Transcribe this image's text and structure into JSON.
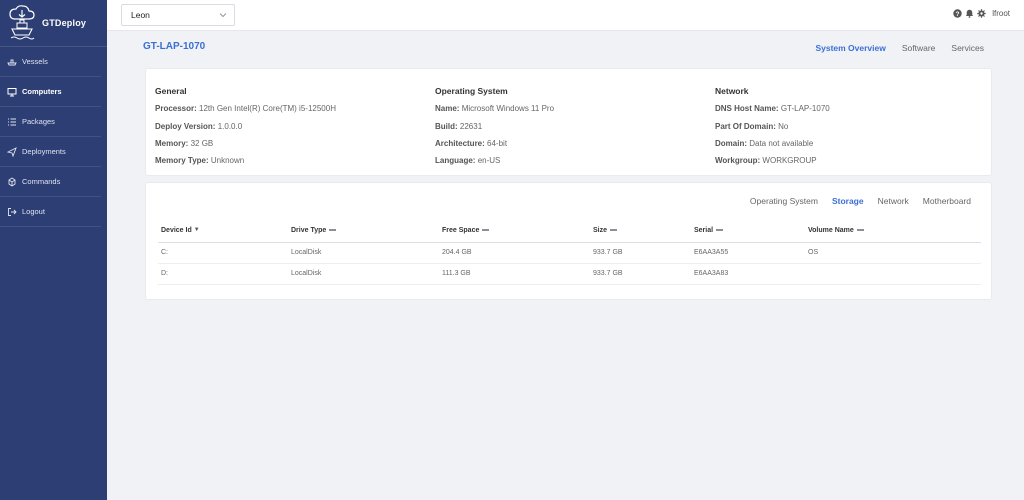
{
  "app": {
    "name": "GTDeploy"
  },
  "sidebar": {
    "items": [
      {
        "label": "Vessels",
        "icon": "ship-icon",
        "active": false
      },
      {
        "label": "Computers",
        "icon": "computer-icon",
        "active": true
      },
      {
        "label": "Packages",
        "icon": "list-icon",
        "active": false
      },
      {
        "label": "Deployments",
        "icon": "send-icon",
        "active": false
      },
      {
        "label": "Commands",
        "icon": "commands-icon",
        "active": false
      },
      {
        "label": "Logout",
        "icon": "logout-icon",
        "active": false
      }
    ]
  },
  "topbar": {
    "selected_site": "Leon",
    "user": "lfroot",
    "icons": [
      "help-icon",
      "bell-icon",
      "gear-icon"
    ]
  },
  "page": {
    "title": "GT-LAP-1070",
    "tabs": [
      {
        "label": "System Overview",
        "active": true
      },
      {
        "label": "Software",
        "active": false
      },
      {
        "label": "Services",
        "active": false
      }
    ]
  },
  "overview": {
    "general": {
      "heading": "General",
      "rows": [
        {
          "key": "Processor:",
          "value": "12th Gen Intel(R) Core(TM) i5-12500H"
        },
        {
          "key": "Deploy Version:",
          "value": "1.0.0.0"
        },
        {
          "key": "Memory:",
          "value": "32 GB"
        },
        {
          "key": "Memory Type:",
          "value": "Unknown"
        }
      ]
    },
    "os": {
      "heading": "Operating System",
      "rows": [
        {
          "key": "Name:",
          "value": "Microsoft Windows 11 Pro"
        },
        {
          "key": "Build:",
          "value": "22631"
        },
        {
          "key": "Architecture:",
          "value": "64-bit"
        },
        {
          "key": "Language:",
          "value": "en-US"
        }
      ]
    },
    "network": {
      "heading": "Network",
      "rows": [
        {
          "key": "DNS Host Name:",
          "value": "GT-LAP-1070"
        },
        {
          "key": "Part Of Domain:",
          "value": "No"
        },
        {
          "key": "Domain:",
          "value": "Data not available"
        },
        {
          "key": "Workgroup:",
          "value": "WORKGROUP"
        }
      ]
    }
  },
  "detail_tabs": [
    {
      "label": "Operating System",
      "active": false
    },
    {
      "label": "Storage",
      "active": true
    },
    {
      "label": "Network",
      "active": false
    },
    {
      "label": "Motherboard",
      "active": false
    }
  ],
  "storage_table": {
    "columns": [
      "Device Id",
      "Drive Type",
      "Free Space",
      "Size",
      "Serial",
      "Volume Name"
    ],
    "rows": [
      [
        "C:",
        "LocalDisk",
        "204.4 GB",
        "933.7 GB",
        "E6AA3A55",
        "OS"
      ],
      [
        "D:",
        "LocalDisk",
        "111.3 GB",
        "933.7 GB",
        "E6AA3A83",
        ""
      ]
    ]
  },
  "colors": {
    "sidebar_bg": "#2c3e73",
    "accent": "#3b6fd6",
    "page_bg": "#f0f2f5"
  }
}
